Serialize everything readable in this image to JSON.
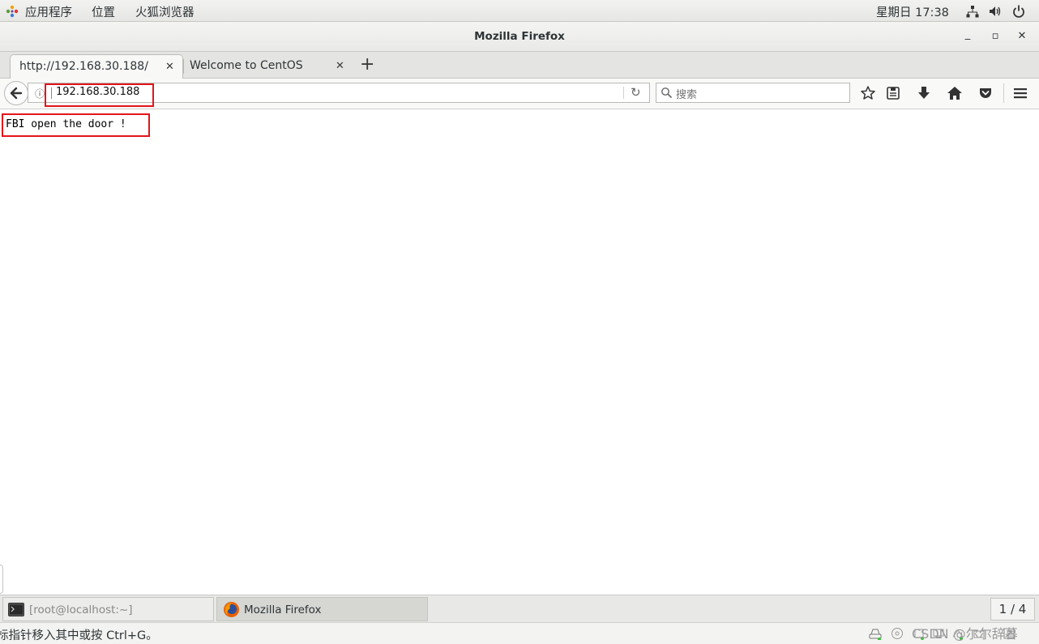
{
  "topbar": {
    "apps_menu": "应用程序",
    "places_menu": "位置",
    "firefox_menu": "火狐浏览器",
    "clock": "星期日 17:38"
  },
  "window": {
    "title": "Mozilla Firefox",
    "minimize": "_",
    "maximize": "▫",
    "close": "✕"
  },
  "tabs": [
    {
      "label": "http://192.168.30.188/",
      "close": "✕",
      "active": true
    },
    {
      "label": "Welcome to CentOS",
      "close": "✕",
      "active": false
    }
  ],
  "new_tab": "+",
  "navbar": {
    "url": "192.168.30.188",
    "reload": "↻",
    "search_placeholder": "搜索",
    "info": "i"
  },
  "page": {
    "body_text": "FBI open the door !"
  },
  "taskbar": {
    "terminal_task": "[root@localhost:~]",
    "firefox_task": "Mozilla Firefox",
    "workspace": "1 / 4"
  },
  "statusbar": {
    "hint": "标指针移入其中或按 Ctrl+G。",
    "watermark": "CSDN @尔尔辞暮"
  },
  "colors": {
    "highlight_box": "#e4141b",
    "firefox_orange": "#e66000"
  }
}
